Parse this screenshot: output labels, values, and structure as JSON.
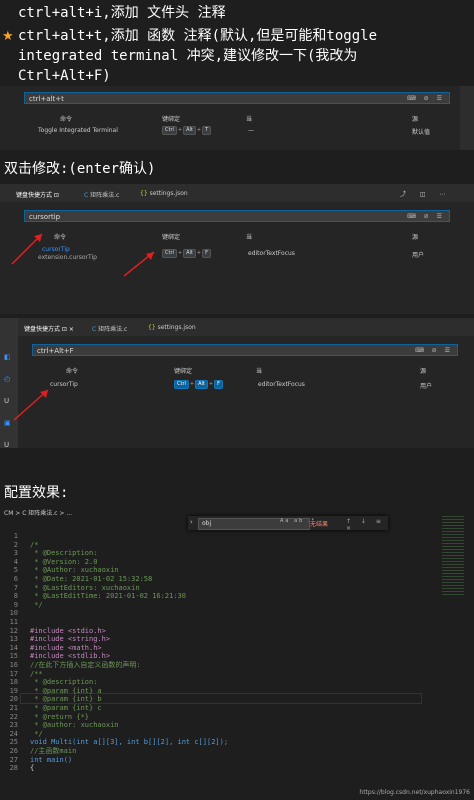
{
  "notes": {
    "line1": "ctrl+alt+i,添加 文件头 注释",
    "line2": "ctrl+alt+t,添加 函数 注释(默认,但是可能和toggle",
    "line3": "integrated terminal 冲突,建议修改一下(我改为",
    "line4": "Ctrl+Alt+F)",
    "star": "★",
    "section2_title": "双击修改:(enter确认)",
    "section3_title": "配置效果:"
  },
  "panel1": {
    "search_value": "ctrl+alt+t",
    "col_command": "命令",
    "col_keybinding": "键绑定",
    "col_when": "当",
    "col_source": "源",
    "row_command": "Toggle Integrated Terminal",
    "row_keys": [
      "Ctrl",
      "Alt",
      "T"
    ],
    "row_when": "—",
    "row_source": "默认值"
  },
  "panel2": {
    "tabs": [
      "键盘快捷方式",
      "矩阵乘法.c",
      "settings.json"
    ],
    "search_value": "cursortip",
    "col_command": "命令",
    "col_keybinding": "键绑定",
    "col_when": "当",
    "col_source": "源",
    "row_command": "cursorTip",
    "row_command_id": "extension.cursorTip",
    "row_keys": [
      "Ctrl",
      "Alt",
      "F"
    ],
    "row_when": "editorTextFocus",
    "row_source": "用户"
  },
  "panel3": {
    "tabs": [
      "键盘快捷方式",
      "矩阵乘法.c",
      "settings.json"
    ],
    "search_value": "ctrl+Alt+F",
    "col_command": "命令",
    "col_keybinding": "键绑定",
    "col_when": "当",
    "col_source": "源",
    "row_command": "cursorTip",
    "row_keys": [
      "Ctrl",
      "Alt",
      "F"
    ],
    "row_when": "editorTextFocus",
    "row_source": "用户"
  },
  "editor": {
    "breadcrumb": "CM > C 矩阵乘法.c > ...",
    "find_value": "obj",
    "find_options": "Aa ab .*",
    "find_result": "无结果",
    "find_nav": "↑ ↓ ≡ ×",
    "watermark": "https://blog.csdn.net/xuphaoxin1976",
    "lines": [
      {
        "n": "1",
        "t": ""
      },
      {
        "n": "2",
        "t": "/*"
      },
      {
        "n": "3",
        "t": " * @Description:"
      },
      {
        "n": "4",
        "t": " * @Version: 2.0"
      },
      {
        "n": "5",
        "t": " * @Author: xuchaoxin"
      },
      {
        "n": "6",
        "t": " * @Date: 2021-01-02 15:32:58"
      },
      {
        "n": "7",
        "t": " * @LastEditors: xuchaoxin"
      },
      {
        "n": "8",
        "t": " * @LastEditTime: 2021-01-02 16:21:30"
      },
      {
        "n": "9",
        "t": " */"
      },
      {
        "n": "10",
        "t": ""
      },
      {
        "n": "11",
        "t": ""
      },
      {
        "n": "12",
        "t": "#include <stdio.h>"
      },
      {
        "n": "13",
        "t": "#include <string.h>"
      },
      {
        "n": "14",
        "t": "#include <math.h>"
      },
      {
        "n": "15",
        "t": "#include <stdlib.h>"
      },
      {
        "n": "16",
        "t": "//在此下方插入自定义函数的声明:"
      },
      {
        "n": "17",
        "t": "/**"
      },
      {
        "n": "18",
        "t": " * @description:"
      },
      {
        "n": "19",
        "t": " * @param {int} a"
      },
      {
        "n": "20",
        "t": " * @param {int} b"
      },
      {
        "n": "21",
        "t": " * @param {int} c"
      },
      {
        "n": "22",
        "t": " * @return {*}"
      },
      {
        "n": "23",
        "t": " * @author: xuchaoxin"
      },
      {
        "n": "24",
        "t": " */"
      },
      {
        "n": "25",
        "t": "void Multi(int a[][3], int b[][2], int c[][2]);"
      },
      {
        "n": "26",
        "t": "//主函数main"
      },
      {
        "n": "27",
        "t": "int main()"
      },
      {
        "n": "28",
        "t": "{"
      }
    ]
  }
}
